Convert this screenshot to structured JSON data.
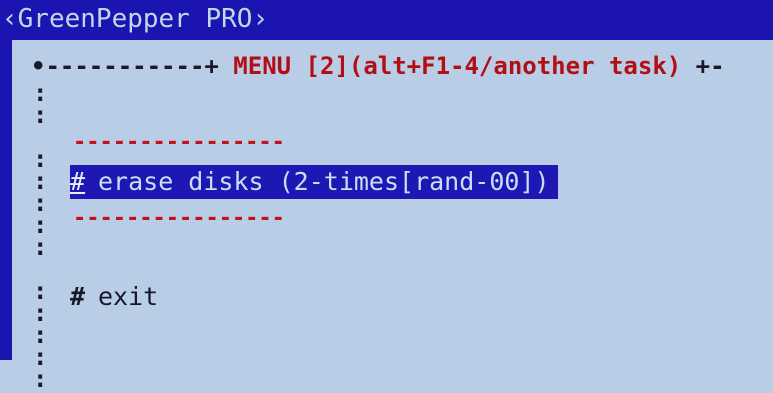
{
  "app": {
    "title": "‹GreenPepper PRO›"
  },
  "menu_frame": {
    "left_dashes": "•-----------+",
    "title": " MENU [2](alt+F1-4/another task) ",
    "right_dashes": "+-"
  },
  "separators": {
    "top": "----------------",
    "bottom": "----------------"
  },
  "border": {
    "left_marks": ":\n:\n\n:\n:\n:\n:\n:\n\n:\n:\n:\n:\n:"
  },
  "menu": {
    "items": [
      {
        "bullet": "#",
        "label": "erase disks (2-times[rand-00])",
        "selected": true
      },
      {
        "bullet": "#",
        "label": "exit",
        "selected": false
      }
    ]
  },
  "colors": {
    "screen_bg": "#b9cde6",
    "bar_bg": "#1b14b0",
    "title_text": "#bcd8ea",
    "menu_header_text": "#b10e15",
    "selection_bg": "#1e17b4",
    "selection_text": "#c6e0f2",
    "normal_text": "#18182a"
  }
}
